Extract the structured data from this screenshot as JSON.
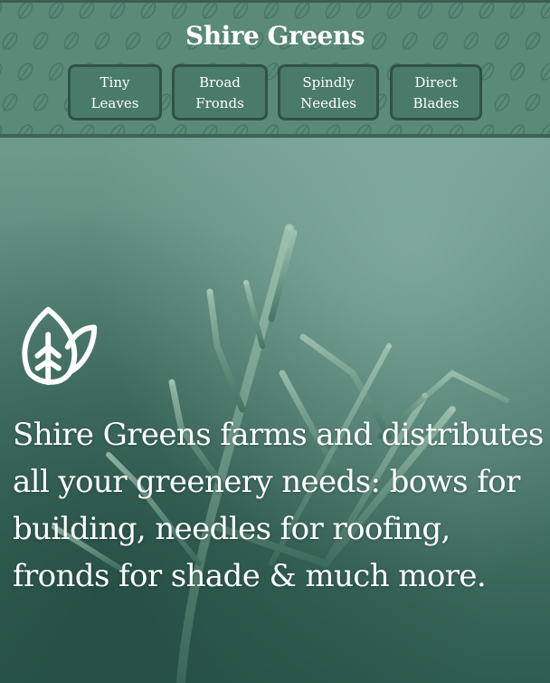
{
  "header": {
    "title": "Shire Greens",
    "pattern_icon": "leaf-icon",
    "nav": [
      {
        "label": "Tiny\nLeaves"
      },
      {
        "label": "Broad\nFronds"
      },
      {
        "label": "Spindly\nNeedles"
      },
      {
        "label": "Direct\nBlades"
      }
    ]
  },
  "hero": {
    "icon": "leaf-logo-icon",
    "tagline": "Shire Greens farms and distributes all your greenery needs: bows for building, needles for roofing, fronds for shade & much more."
  },
  "colors": {
    "header_bg": "#5a8a78",
    "nav_btn_bg": "#4a7a6a",
    "nav_btn_border": "#2f5247",
    "text": "#ffffff"
  }
}
